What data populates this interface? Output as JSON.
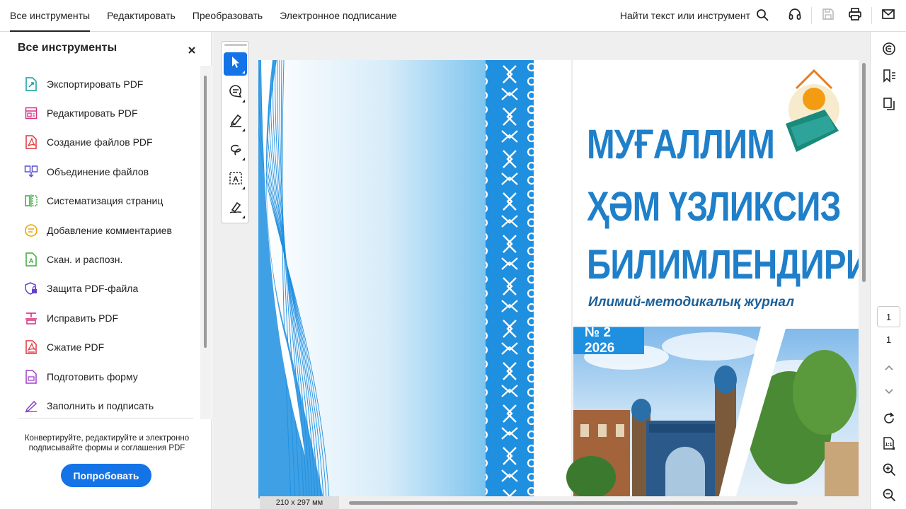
{
  "topbar": {
    "tabs": [
      {
        "label": "Все инструменты",
        "active": true
      },
      {
        "label": "Редактировать",
        "active": false
      },
      {
        "label": "Преобразовать",
        "active": false
      },
      {
        "label": "Электронное подписание",
        "active": false
      }
    ],
    "find_label": "Найти текст или инструмент",
    "icons": [
      "search-icon",
      "headphones-icon",
      "save-icon",
      "print-icon",
      "mail-icon"
    ]
  },
  "left_panel": {
    "title": "Все инструменты",
    "close_icon": "close-icon",
    "tools": [
      {
        "label": "Экспортировать PDF",
        "icon": "export-pdf-icon",
        "color": "#0f9e9e"
      },
      {
        "label": "Редактировать PDF",
        "icon": "edit-pdf-icon",
        "color": "#d6307e"
      },
      {
        "label": "Создание файлов PDF",
        "icon": "create-pdf-icon",
        "color": "#e0343c"
      },
      {
        "label": "Объединение файлов",
        "icon": "combine-files-icon",
        "color": "#5a4fd6"
      },
      {
        "label": "Систематизация страниц",
        "icon": "organize-pages-icon",
        "color": "#3ea83e"
      },
      {
        "label": "Добавление комментариев",
        "icon": "comment-icon",
        "color": "#e8a800"
      },
      {
        "label": "Скан. и распозн.",
        "icon": "scan-ocr-icon",
        "color": "#3ea83e"
      },
      {
        "label": "Защита PDF-файла",
        "icon": "protect-pdf-icon",
        "color": "#6a3fc9"
      },
      {
        "label": "Исправить PDF",
        "icon": "redact-pdf-icon",
        "color": "#d6307e"
      },
      {
        "label": "Сжатие PDF",
        "icon": "compress-pdf-icon",
        "color": "#e0343c"
      },
      {
        "label": "Подготовить форму",
        "icon": "prepare-form-icon",
        "color": "#a03fc9"
      },
      {
        "label": "Заполнить и подписать",
        "icon": "fill-sign-icon",
        "color": "#8a3fc9"
      }
    ],
    "promo_text": "Конвертируйте, редактируйте и электронно подписывайте формы и соглашения PDF",
    "try_button": "Попробовать"
  },
  "float_toolbar": {
    "tools": [
      "select-cursor-icon",
      "add-comment-icon",
      "highlight-pen-icon",
      "draw-freeform-icon",
      "text-select-icon",
      "fill-sign-pen-icon"
    ]
  },
  "document": {
    "cover": {
      "title_line1": "МУҒАЛЛИМ",
      "title_line2": "ҲӘМ ҮЗЛИКСИЗ",
      "title_line3": "БИЛИМЛЕНДИРИЎ",
      "subtitle": "Илимий-методикалық журнал",
      "issue": "№ 2 2026"
    },
    "page_size": "210 x 297 мм"
  },
  "right_rail": {
    "icons": [
      "ai-assistant-icon",
      "bookmarks-icon",
      "copy-pages-icon",
      "chevron-up-icon",
      "chevron-down-icon",
      "refresh-icon",
      "page-fit-icon",
      "zoom-in-icon",
      "zoom-out-icon"
    ],
    "current_page": "1",
    "total_pages": "1"
  },
  "colors": {
    "accent": "#1473e6",
    "cover_blue": "#1f8fe0",
    "title_blue": "#1f7fc9"
  }
}
